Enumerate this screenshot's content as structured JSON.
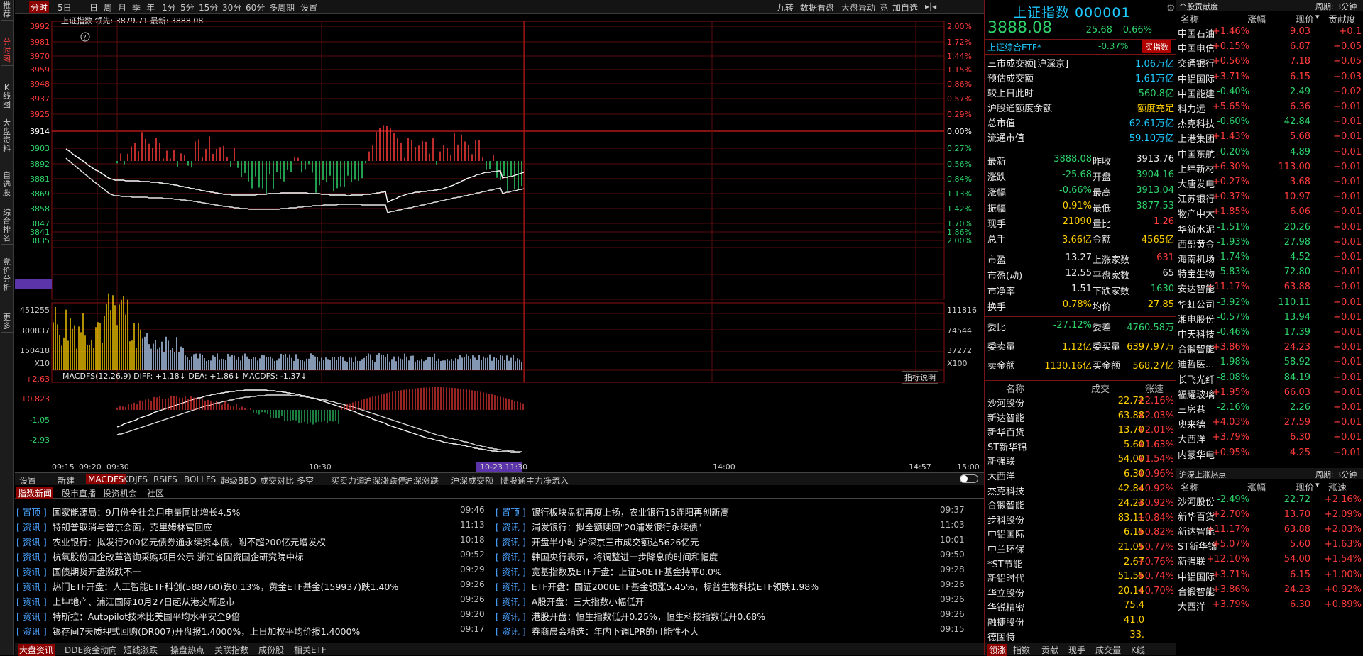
{
  "vnav": [
    "推荐",
    "分时图",
    "K线图",
    "大盘资料",
    "自选股",
    "综合排名",
    "竞价分析",
    "更多"
  ],
  "toolbar": {
    "left": [
      "分时",
      "5日",
      "日",
      "周",
      "月",
      "季",
      "年",
      "1分",
      "5分",
      "15分",
      "30分",
      "60分",
      "多周期",
      "设置"
    ],
    "right": [
      "九转",
      "数据看盘",
      "大盘异动",
      "竞",
      "加自选"
    ]
  },
  "info": {
    "name": "上证指数",
    "lead_label": "领先:",
    "lead": "3879.71",
    "latest_label": "最新:",
    "latest": "3888.08"
  },
  "chart": {
    "left_ticks": [
      "3992",
      "3981",
      "3970",
      "3959",
      "3948",
      "3937",
      "3925",
      "3914",
      "3903",
      "3892",
      "3881",
      "3869",
      "3858",
      "3847",
      "3841",
      "3835"
    ],
    "right_ticks": [
      "2.00%",
      "1.72%",
      "1.44%",
      "1.15%",
      "0.86%",
      "0.57%",
      "0.29%",
      "0.00%",
      "0.27%",
      "0.56%",
      "0.84%",
      "1.13%",
      "1.42%",
      "1.70%",
      "1.86%",
      "2.00%"
    ],
    "vol_left": [
      "451255",
      "300837",
      "150418",
      "X10"
    ],
    "vol_right": [
      "111816",
      "74544",
      "37272",
      "X100"
    ],
    "macd_left": [
      "+2.63",
      "+0.823",
      "-1.05",
      "-2.93"
    ],
    "macd_label": "MACDFS(12,26,9) DIFF: +1.18↓ DEA: +1.86↓ MACDFS: -1.37↓",
    "indicator_help": "指标说明",
    "time_ticks": [
      "09:15",
      "09:20",
      "09:30",
      "10:30",
      "10-23 11:30",
      "14:00",
      "14:57",
      "15:00"
    ]
  },
  "ind_tabs": [
    "设置",
    "新建",
    "MACDFS",
    "KDJFS",
    "RSIFS",
    "BOLLFS",
    "超级BBD",
    "成交对比",
    "多空",
    "买卖力道",
    "沪深涨跌停",
    "沪深涨跌",
    "沪深成交额",
    "陆股通主力净流入"
  ],
  "news_tabs": [
    "指数新闻",
    "股市直播",
    "投资机会",
    "社区"
  ],
  "news_left": [
    {
      "tag": "置顶",
      "title": "国家能源局：9月份全社会用电量同比增长4.5%",
      "time": "09:46"
    },
    {
      "tag": "资讯",
      "title": "特朗普取消与普京会面，克里姆林宫回应",
      "time": "11:13"
    },
    {
      "tag": "资讯",
      "title": "农业银行：拟发行200亿元债券通永续资本债，附不超200亿元增发权",
      "time": "10:18"
    },
    {
      "tag": "资讯",
      "title": "杭氧股份国企改革咨询采购项目公示 浙江省国资国企研究院中标",
      "time": "09:52"
    },
    {
      "tag": "资讯",
      "title": "国债期货开盘涨跌不一",
      "time": "09:29"
    },
    {
      "tag": "资讯",
      "title": "热门ETF开盘：人工智能ETF科创(588760)跌0.13%，黄金ETF基金(159937)跌1.40%",
      "time": "09:26"
    },
    {
      "tag": "资讯",
      "title": "上坤地产、浦江国际10月27日起从港交所退市",
      "time": "09:26"
    },
    {
      "tag": "资讯",
      "title": "特斯拉：Autopilot技术比美国平均水平安全9倍",
      "time": "09:20"
    },
    {
      "tag": "资讯",
      "title": "银存间7天质押式回购(DR007)开盘报1.4000%，上日加权平均价报1.4000%",
      "time": "09:17"
    }
  ],
  "news_right": [
    {
      "tag": "置顶",
      "title": "银行板块盘初再度上扬，农业银行15连阳再创新高",
      "time": "09:37"
    },
    {
      "tag": "资讯",
      "title": "浦发银行：拟全额赎回\"20浦发银行永续债\"",
      "time": "11:03"
    },
    {
      "tag": "资讯",
      "title": "开盘半小时 沪深京三市成交额达5626亿元",
      "time": "10:01"
    },
    {
      "tag": "资讯",
      "title": "韩国央行表示，将调整进一步降息的时间和幅度",
      "time": "09:50"
    },
    {
      "tag": "资讯",
      "title": "宽基指数及ETF开盘：上证50ETF基金持平0.0%",
      "time": "09:28"
    },
    {
      "tag": "资讯",
      "title": "ETF开盘：国证2000ETF基金领涨5.45%，标普生物科技ETF领跌1.98%",
      "time": "09:26"
    },
    {
      "tag": "资讯",
      "title": "A股开盘：三大指数小幅低开",
      "time": "09:26"
    },
    {
      "tag": "资讯",
      "title": "港股开盘：恒生指数低开0.25%，恒生科技指数低开0.68%",
      "time": "09:26"
    },
    {
      "tag": "资讯",
      "title": "券商晨会精选：年内下调LPR的可能性不大",
      "time": "09:15"
    }
  ],
  "bottom_tabs": [
    "大盘资讯",
    "DDE资金动向",
    "短线涨跌",
    "操盘热点",
    "关联指数",
    "成份股",
    "相关ETF"
  ],
  "quote": {
    "title": "上证指数 000001",
    "price": "3888.08",
    "change": "-25.68",
    "pct": "-0.66%",
    "etf": {
      "name": "上证综合ETF",
      "pct": "-0.37%",
      "btn": "买指数"
    },
    "stats1": [
      {
        "label": "三市成交额[沪深京]",
        "value": "1.06万亿",
        "color": "cyan"
      },
      {
        "label": "预估成交额",
        "value": "1.61万亿",
        "color": "cyan"
      },
      {
        "label": "较上日此时",
        "value": "-560.8亿",
        "color": "green"
      },
      {
        "label": "沪股通额度余额",
        "value": "额度充足",
        "color": "yellow"
      },
      {
        "label": "总市值",
        "value": "62.61万亿",
        "color": "cyan"
      },
      {
        "label": "流通市值",
        "value": "59.10万亿",
        "color": "cyan"
      }
    ],
    "stats2": [
      {
        "l1": "最新",
        "v1": "3888.08",
        "c1": "green",
        "l2": "昨收",
        "v2": "3913.76",
        "c2": "white"
      },
      {
        "l1": "涨跌",
        "v1": "-25.68",
        "c1": "green",
        "l2": "开盘",
        "v2": "3904.16",
        "c2": "green"
      },
      {
        "l1": "涨幅",
        "v1": "-0.66%",
        "c1": "green",
        "l2": "最高",
        "v2": "3913.04",
        "c2": "green"
      },
      {
        "l1": "振幅",
        "v1": "0.91%",
        "c1": "yellow",
        "l2": "最低",
        "v2": "3877.53",
        "c2": "green"
      },
      {
        "l1": "现手",
        "v1": "21090",
        "c1": "yellow",
        "l2": "量比",
        "v2": "1.26",
        "c2": "red"
      },
      {
        "l1": "总手",
        "v1": "3.66亿",
        "c1": "yellow",
        "l2": "金额",
        "v2": "4565亿",
        "c2": "yellow"
      }
    ],
    "stats3": [
      {
        "l1": "市盈",
        "v1": "13.27",
        "c1": "white",
        "l2": "上涨家数",
        "v2": "631",
        "c2": "red"
      },
      {
        "l1": "市盈(动)",
        "v1": "12.55",
        "c1": "white",
        "l2": "平盘家数",
        "v2": "65",
        "c2": "white"
      },
      {
        "l1": "市净率",
        "v1": "1.51",
        "c1": "white",
        "l2": "下跌家数",
        "v2": "1630",
        "c2": "green"
      },
      {
        "l1": "换手",
        "v1": "0.78%",
        "c1": "yellow",
        "l2": "均价",
        "v2": "27.85",
        "c2": "yellow"
      }
    ],
    "stats4": [
      {
        "l1": "委比",
        "v1": "-27.12%",
        "c1": "green",
        "l2": "委差",
        "v2": "-4760.58万",
        "c2": "green"
      },
      {
        "l1": "委卖量",
        "v1": "1.12亿",
        "c1": "yellow",
        "l2": "委买量",
        "v2": "6397.97万",
        "c2": "yellow"
      },
      {
        "l1": "卖金额",
        "v1": "1130.16亿",
        "c1": "yellow",
        "l2": "买金额",
        "v2": "568.27亿",
        "c2": "yellow"
      }
    ],
    "list_head": [
      "名称",
      "成交",
      "涨速"
    ],
    "list": [
      [
        "沙河股份",
        "22.72",
        "+2.16%"
      ],
      [
        "新达智能",
        "63.88",
        "+2.03%"
      ],
      [
        "新华百货",
        "13.70",
        "+2.01%"
      ],
      [
        "ST新华锦",
        "5.60",
        "+1.63%"
      ],
      [
        "新强联",
        "54.00",
        "+1.54%"
      ],
      [
        "大西洋",
        "6.30",
        "+0.96%"
      ],
      [
        "杰克科技",
        "42.84",
        "+0.92%"
      ],
      [
        "合锻智能",
        "24.23",
        "+0.92%"
      ],
      [
        "步科股份",
        "83.11",
        "+0.84%"
      ],
      [
        "中铝国际",
        "6.15",
        "+0.82%"
      ],
      [
        "中兰环保",
        "21.05",
        "+0.77%"
      ],
      [
        "*ST节能",
        "2.67",
        "+0.76%"
      ],
      [
        "新铝时代",
        "51.55",
        "+0.74%"
      ],
      [
        "华立股份",
        "20.14",
        "+0.70%"
      ],
      [
        "华锐精密",
        "75.4",
        ""
      ],
      [
        "融捷股份",
        "41.0",
        ""
      ],
      [
        "德固特",
        "33.",
        ""
      ]
    ],
    "bottom_tabs": [
      "领涨",
      "指数",
      "贡献",
      "现手",
      "成交量",
      "K线"
    ]
  },
  "rank1": {
    "title": "个股贡献度",
    "period": "周期: 3分钟",
    "head": [
      "名称",
      "涨幅",
      "现价",
      "贡献度"
    ],
    "rows": [
      [
        "中国石油",
        "+1.46%",
        "9.03",
        "+0.1"
      ],
      [
        "中国电信",
        "+0.15%",
        "6.87",
        "+0.05"
      ],
      [
        "交通银行",
        "+0.56%",
        "7.18",
        "+0.05"
      ],
      [
        "中铝国际",
        "+3.71%",
        "6.15",
        "+0.03"
      ],
      [
        "中国能建",
        "-0.40%",
        "2.49",
        "+0.02"
      ],
      [
        "科力远",
        "+5.65%",
        "6.36",
        "+0.01"
      ],
      [
        "杰克科技",
        "-0.60%",
        "42.84",
        "+0.01"
      ],
      [
        "上港集团",
        "+1.43%",
        "5.68",
        "+0.01"
      ],
      [
        "中国东航",
        "-0.20%",
        "4.89",
        "+0.01"
      ],
      [
        "上纬新材",
        "+6.30%",
        "113.00",
        "+0.01"
      ],
      [
        "大唐发电",
        "+0.27%",
        "3.68",
        "+0.01"
      ],
      [
        "江苏银行",
        "+0.37%",
        "10.97",
        "+0.01"
      ],
      [
        "物产中大",
        "+1.85%",
        "6.06",
        "+0.01"
      ],
      [
        "华新水泥",
        "-1.51%",
        "20.26",
        "+0.01"
      ],
      [
        "西部黄金",
        "-1.93%",
        "27.98",
        "+0.01"
      ],
      [
        "海南机场",
        "-1.74%",
        "4.52",
        "+0.01"
      ],
      [
        "特宝生物",
        "-5.83%",
        "72.80",
        "+0.01"
      ],
      [
        "安达智能",
        "+11.17%",
        "63.88",
        "+0.01"
      ],
      [
        "华虹公司",
        "-3.92%",
        "110.11",
        "+0.01"
      ],
      [
        "湘电股份",
        "-0.57%",
        "13.94",
        "+0.01"
      ],
      [
        "中天科技",
        "-0.46%",
        "17.39",
        "+0.01"
      ],
      [
        "合锻智能",
        "+3.86%",
        "24.23",
        "+0.01"
      ],
      [
        "迪哲医...",
        "-1.98%",
        "58.92",
        "+0.01"
      ],
      [
        "长飞光纤",
        "-8.08%",
        "84.19",
        "+0.01"
      ],
      [
        "福耀玻璃",
        "+1.95%",
        "66.03",
        "+0.01"
      ],
      [
        "三房巷",
        "-2.16%",
        "2.26",
        "+0.01"
      ],
      [
        "奥来德",
        "+4.03%",
        "27.59",
        "+0.01"
      ],
      [
        "大西洋",
        "+3.79%",
        "6.30",
        "+0.01"
      ],
      [
        "内蒙华电",
        "+0.95%",
        "4.25",
        "+0.01"
      ]
    ]
  },
  "rank2": {
    "title": "沪深上涨热点",
    "period": "周期: 3分钟",
    "head": [
      "名称",
      "涨幅",
      "现价",
      "涨速"
    ],
    "rows": [
      [
        "沙河股份",
        "-2.49%",
        "22.72",
        "+2.16%"
      ],
      [
        "新华百货",
        "+2.70%",
        "13.70",
        "+2.09%"
      ],
      [
        "新达智能",
        "+11.17%",
        "63.88",
        "+2.03%"
      ],
      [
        "ST新华锦",
        "+5.07%",
        "5.60",
        "+1.63%"
      ],
      [
        "新强联",
        "+12.10%",
        "54.00",
        "+1.54%"
      ],
      [
        "中铝国际",
        "+3.71%",
        "6.15",
        "+1.00%"
      ],
      [
        "合锻智能",
        "+3.86%",
        "24.23",
        "+0.92%"
      ],
      [
        "大西洋",
        "+3.79%",
        "6.30",
        "+0.89%"
      ]
    ]
  }
}
